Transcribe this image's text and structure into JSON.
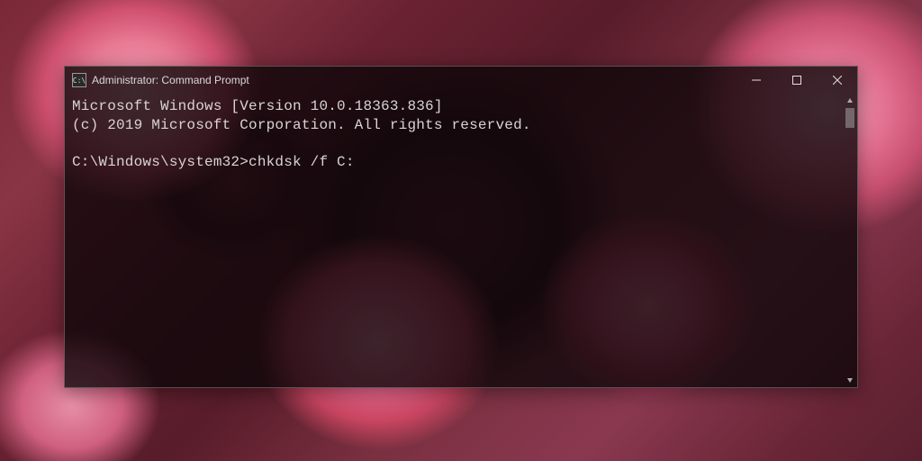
{
  "window": {
    "title": "Administrator: Command Prompt",
    "icon_label": "C:\\"
  },
  "terminal": {
    "line1": "Microsoft Windows [Version 10.0.18363.836]",
    "line2": "(c) 2019 Microsoft Corporation. All rights reserved.",
    "blank": "",
    "prompt": "C:\\Windows\\system32>",
    "command": "chkdsk /f C:"
  }
}
